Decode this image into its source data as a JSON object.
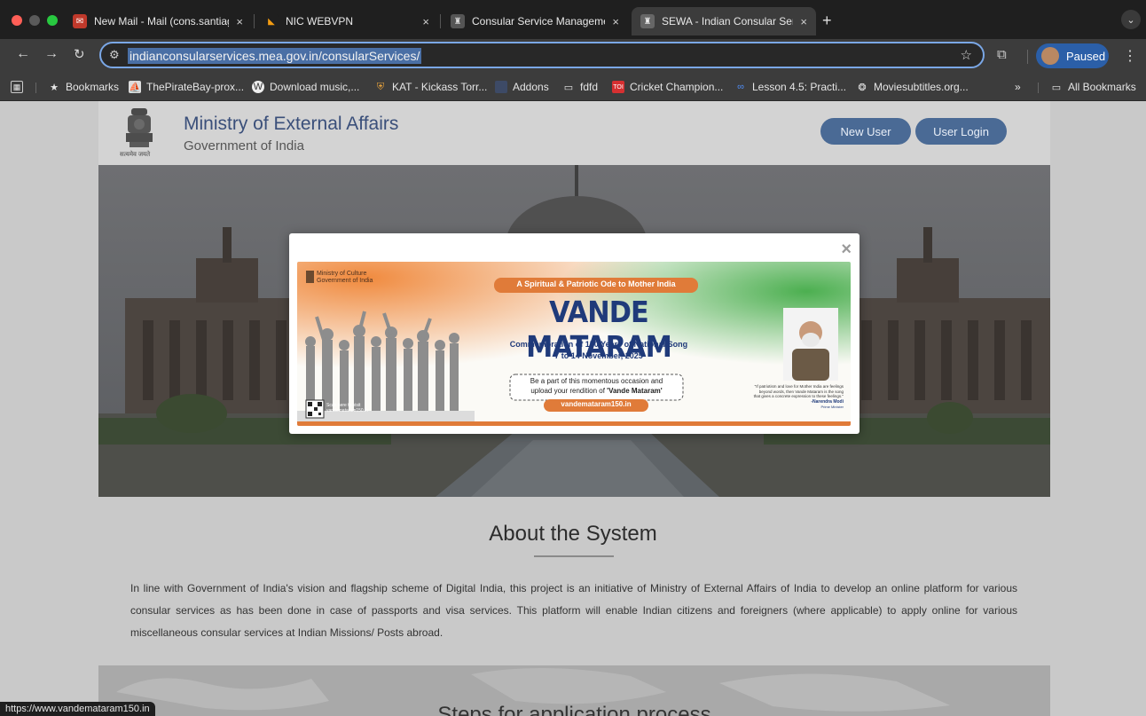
{
  "browser": {
    "tabs": [
      {
        "label": "New Mail - Mail (cons.santiag",
        "active": false
      },
      {
        "label": "NIC WEBVPN",
        "active": false
      },
      {
        "label": "Consular Service Managemen",
        "active": false
      },
      {
        "label": "SEWA - Indian Consular Servi",
        "active": true
      }
    ],
    "url": "indianconsularservices.mea.gov.in/consularServices/",
    "profile_label": "Paused",
    "bookmarks": [
      "Bookmarks",
      "ThePirateBay-prox...",
      "Download music,...",
      "KAT - Kickass Torr...",
      "Addons",
      "fdfd",
      "Cricket Champion...",
      "Lesson 4.5: Practi...",
      "Moviesubtitles.org..."
    ],
    "overflow_label": "»",
    "all_bookmarks_label": "All Bookmarks",
    "status_url": "https://www.vandemataram150.in"
  },
  "header": {
    "title": "Ministry of External Affairs",
    "subtitle": "Government of India",
    "motto": "सत्यमेव जयते",
    "new_user_label": "New User",
    "user_login_label": "User Login"
  },
  "about": {
    "title": "About the System",
    "text": "In line with Government of India's vision and flagship scheme of Digital India, this project is an initiative of Ministry of External Affairs of India to develop an online platform for various consular services as has been done in case of passports and visa services. This platform will enable Indian citizens and foreigners (where applicable) to apply online for various miscellaneous consular services at Indian Missions/ Posts abroad."
  },
  "steps": {
    "title": "Steps for application process"
  },
  "modal": {
    "close_label": "×",
    "banner": {
      "ministry_line1": "Ministry of Culture",
      "ministry_line2": "Government of India",
      "ribbon": "A Spiritual & Patriotic Ode to Mother India",
      "headline": "VANDE MATARAM",
      "commemoration": "Commemoration of 150 Years of National Song",
      "dates": "7 to 14 November, 2025",
      "cta_line1": "Be a part of this momentous occasion and",
      "cta_line2_prefix": "upload your rendition of ",
      "cta_line2_bold": "'Vande Mataram'",
      "website": "vandemataram150.in",
      "qr_text1": "Scan here to visit",
      "qr_text2": "vandemataram150.in",
      "quote_line1": "\"If patriotism and love for Mother India are feelings",
      "quote_line2": "beyond words, then Vande Mataram is the song",
      "quote_line3": "that gives a concrete expression to these feelings.\"",
      "quote_author": "-Narendra Modi",
      "quote_role": "Prime Minister"
    }
  },
  "colors": {
    "accent_blue": "#4a6a95",
    "saffron": "#e07b39",
    "navy": "#1f3a7a",
    "green": "#2f8f3a",
    "chrome_dark": "#1f1f1f"
  }
}
